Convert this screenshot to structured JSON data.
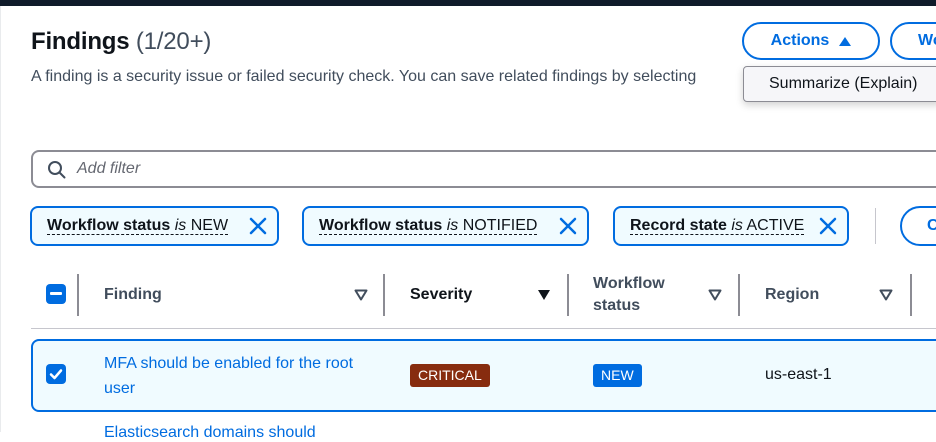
{
  "header": {
    "title": "Findings",
    "count": "(1/20+)",
    "description": "A finding is a security issue or failed security check. You can save related findings by selecting"
  },
  "actions": {
    "actions_label": "Actions",
    "secondary_label": "Workflow status",
    "menu_items": [
      "Summarize (Explain)"
    ]
  },
  "filter": {
    "placeholder": "Add filter"
  },
  "chips": [
    {
      "key": "Workflow status",
      "op": "is",
      "value": "NEW"
    },
    {
      "key": "Workflow status",
      "op": "is",
      "value": "NOTIFIED"
    },
    {
      "key": "Record state",
      "op": "is",
      "value": "ACTIVE"
    }
  ],
  "chip_more_label": "Clear filters",
  "table": {
    "columns": [
      {
        "label": "Finding"
      },
      {
        "label": "Severity"
      },
      {
        "label": "Workflow",
        "label2": "status"
      },
      {
        "label": "Region"
      }
    ],
    "rows": [
      {
        "selected": true,
        "finding": "MFA should be enabled for the root user",
        "severity": "CRITICAL",
        "workflow_status": "NEW",
        "region": "us-east-1"
      }
    ],
    "next_row_partial": "Elasticsearch domains should"
  },
  "colors": {
    "accent": "#006ce0",
    "critical": "#872c0f",
    "selected_bg": "#f0fbff"
  }
}
